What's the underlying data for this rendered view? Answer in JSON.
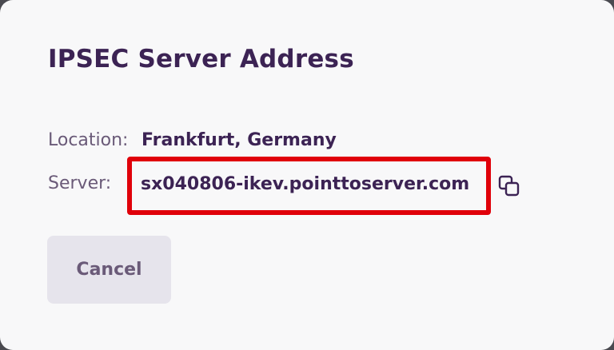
{
  "dialog": {
    "title": "IPSEC Server Address",
    "location_label": "Location:",
    "location_value": "Frankfurt, Germany",
    "server_label": "Server:",
    "server_value": "sx040806-ikev.pointtoserver.com",
    "copy_icon": "copy-icon",
    "cancel_label": "Cancel"
  },
  "colors": {
    "title": "#3c2354",
    "label": "#6a5a78",
    "highlight_border": "#e0000a",
    "button_bg": "#e6e4ec",
    "dialog_bg": "#f8f8f9"
  }
}
